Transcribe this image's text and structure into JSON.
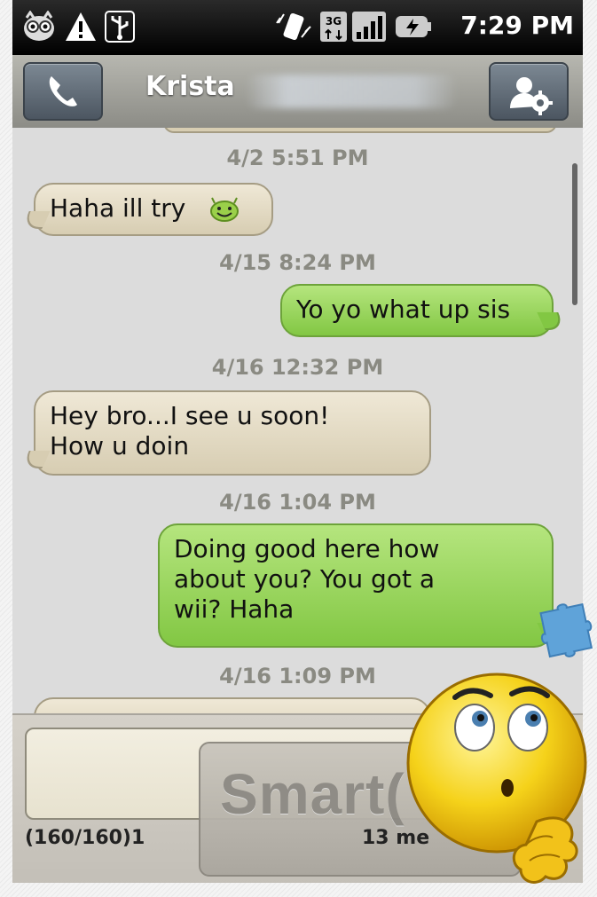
{
  "status_bar": {
    "time": "7:29 PM",
    "icons": [
      "cat-notification-icon",
      "warning-icon",
      "usb-icon",
      "vibrate-icon",
      "3g-data-icon",
      "signal-icon",
      "battery-charging-icon"
    ]
  },
  "title_bar": {
    "contact_name": "Krista",
    "call_icon": "phone-icon",
    "contact_settings_icon": "contact-settings-icon"
  },
  "messages": [
    {
      "timestamp": "4/2 5:51 PM",
      "direction": "in",
      "text": "Haha ill try",
      "emoji": "smiley-icon"
    },
    {
      "timestamp": "4/15 8:24 PM",
      "direction": "out",
      "text": "Yo yo what up sis"
    },
    {
      "timestamp": "4/16 12:32 PM",
      "direction": "in",
      "text": "Hey bro...I see u soon!\nHow u doin"
    },
    {
      "timestamp": "4/16 1:04 PM",
      "direction": "out",
      "text": "Doing good here how\nabout you? You got a\nwii? Haha"
    },
    {
      "timestamp": "4/16 1:09 PM",
      "direction": "in",
      "text": ""
    }
  ],
  "compose": {
    "input_value": "",
    "send_label": "Smart(",
    "char_count": "(160/160)1",
    "message_count": "13 me"
  },
  "colors": {
    "incoming_bubble": "#e3dbc4",
    "outgoing_bubble": "#9bd65c",
    "timestamp": "#8a8a82",
    "title_bar": "#a3a39d"
  }
}
